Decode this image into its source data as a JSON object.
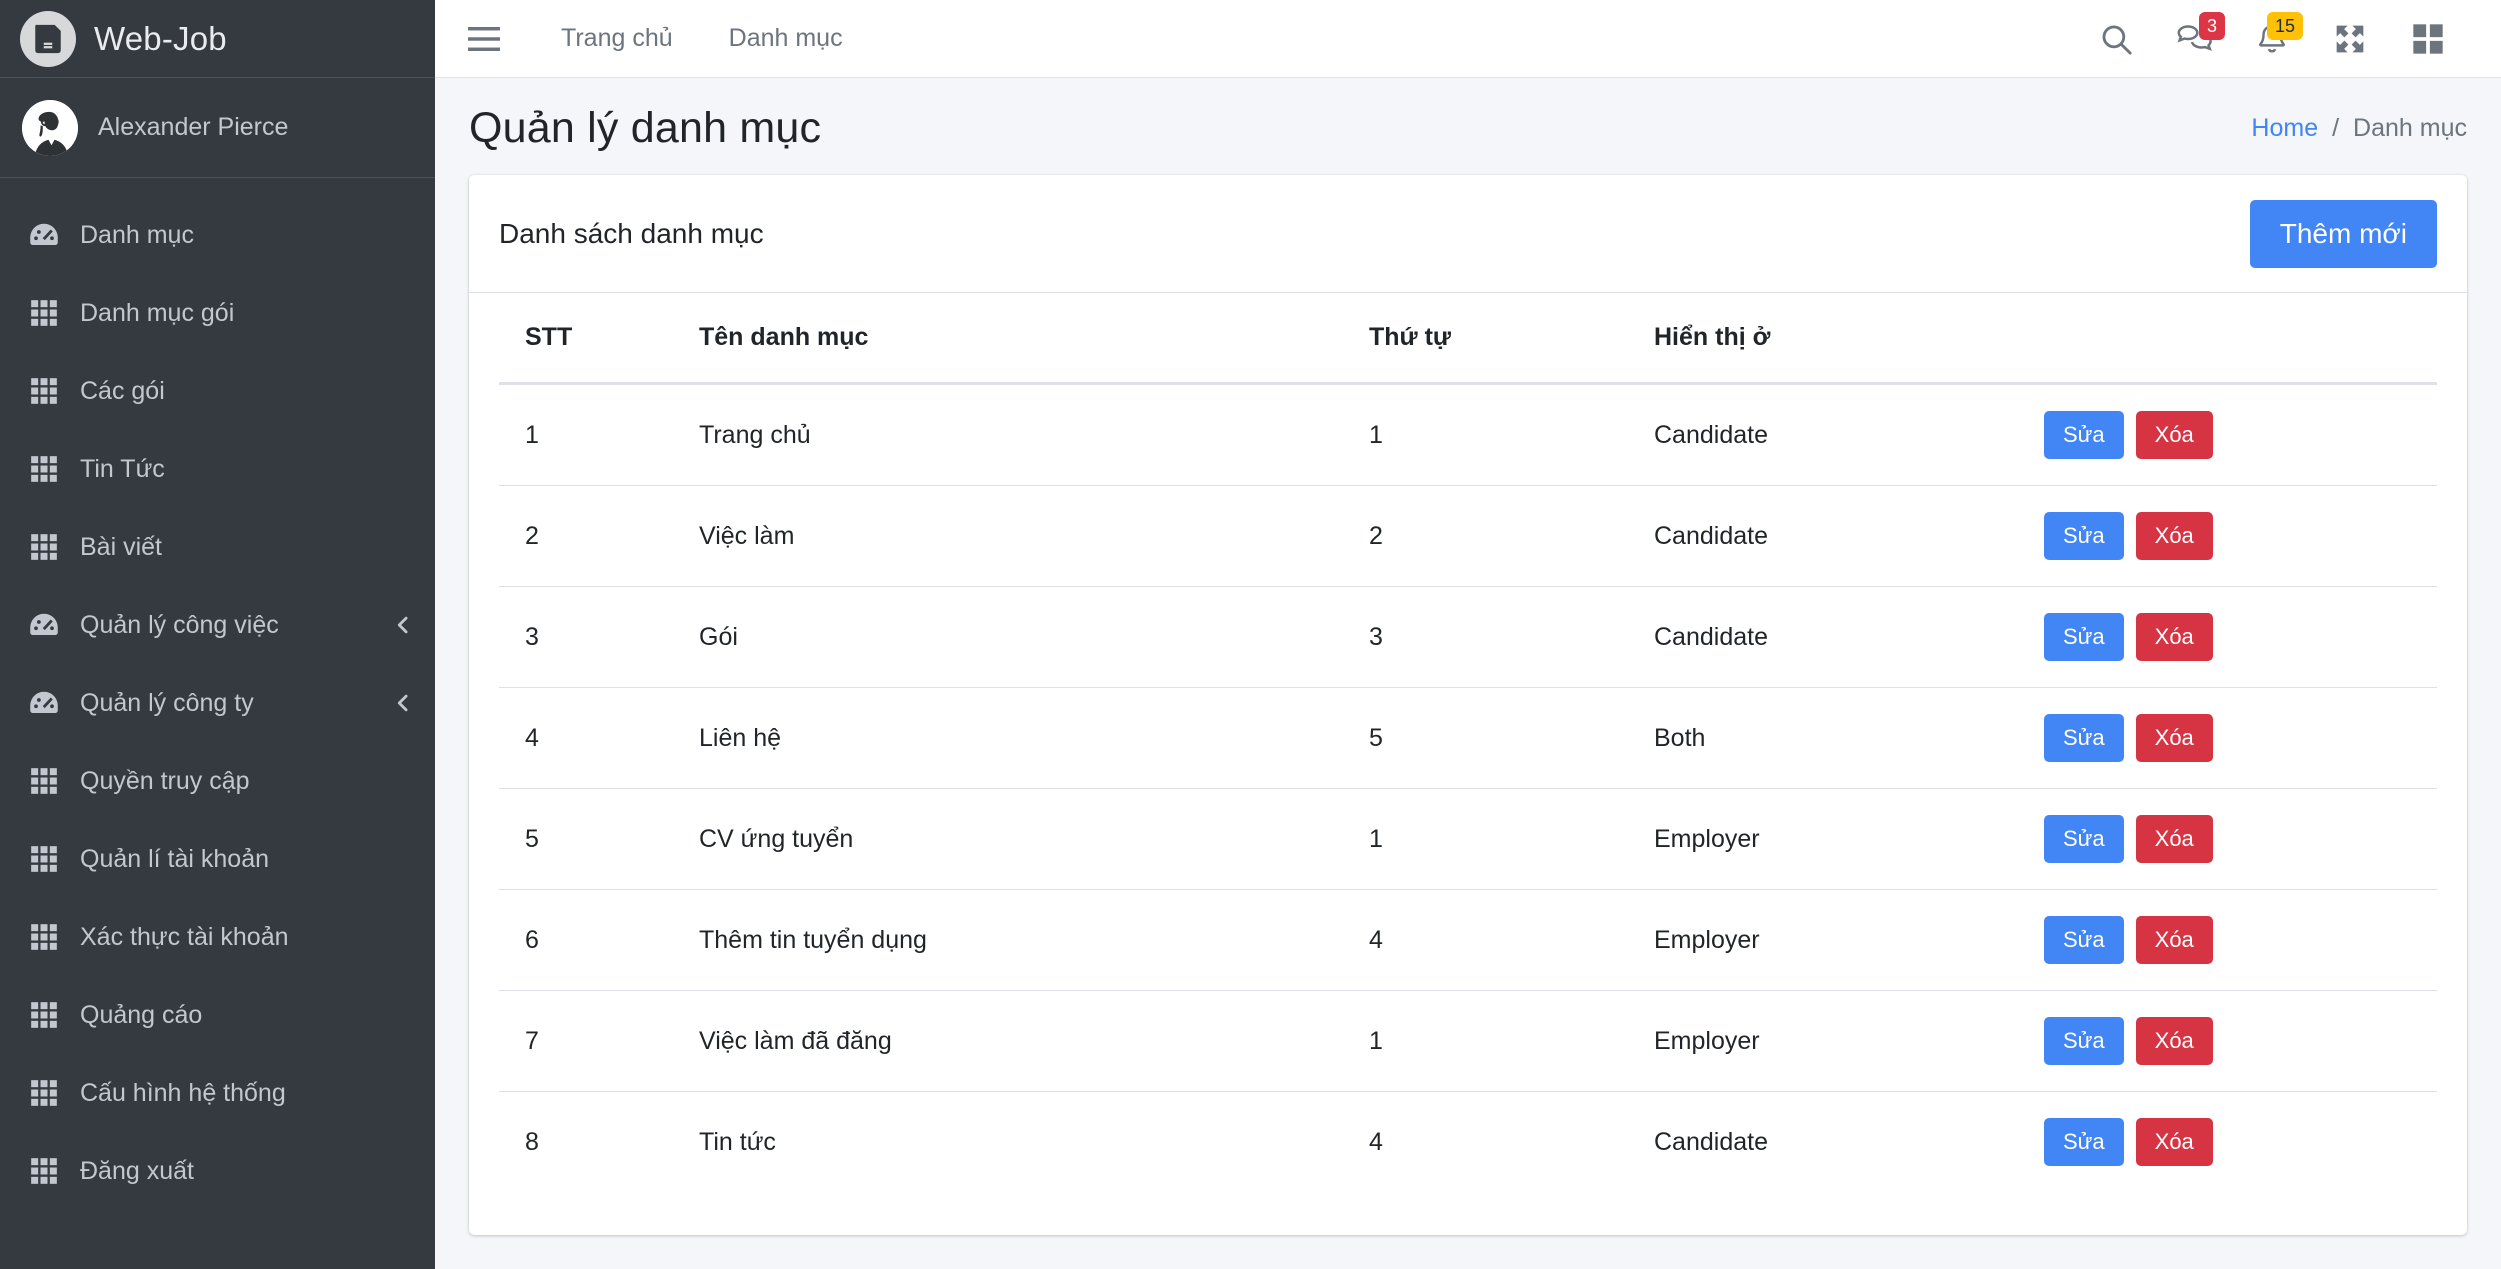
{
  "brand": {
    "name": "Web-Job",
    "logo_icon": "save-disk-icon"
  },
  "user": {
    "name": "Alexander Pierce",
    "avatar_icon": "user-avatar"
  },
  "sidebar": {
    "items": [
      {
        "label": "Danh mục",
        "icon": "dashboard-icon",
        "expandable": false
      },
      {
        "label": "Danh mục gói",
        "icon": "th-grid-icon",
        "expandable": false
      },
      {
        "label": "Các gói",
        "icon": "th-grid-icon",
        "expandable": false
      },
      {
        "label": "Tin Tức",
        "icon": "th-grid-icon",
        "expandable": false
      },
      {
        "label": "Bài viết",
        "icon": "th-grid-icon",
        "expandable": false
      },
      {
        "label": "Quản lý công việc",
        "icon": "dashboard-icon",
        "expandable": true
      },
      {
        "label": "Quản lý công ty",
        "icon": "dashboard-icon",
        "expandable": true
      },
      {
        "label": "Quyền truy cập",
        "icon": "th-grid-icon",
        "expandable": false
      },
      {
        "label": "Quản lí tài khoản",
        "icon": "th-grid-icon",
        "expandable": false
      },
      {
        "label": "Xác thực tài khoản",
        "icon": "th-grid-icon",
        "expandable": false
      },
      {
        "label": "Quảng cáo",
        "icon": "th-grid-icon",
        "expandable": false
      },
      {
        "label": "Cấu hình hệ thống",
        "icon": "th-grid-icon",
        "expandable": false
      },
      {
        "label": "Đăng xuất",
        "icon": "th-grid-icon",
        "expandable": false
      }
    ]
  },
  "navbar": {
    "menu_icon": "hamburger-icon",
    "links": [
      {
        "label": "Trang chủ"
      },
      {
        "label": "Danh mục"
      }
    ],
    "icons": [
      {
        "name": "search-icon",
        "badge": null
      },
      {
        "name": "comments-icon",
        "badge": "3"
      },
      {
        "name": "bell-icon",
        "badge": "15"
      },
      {
        "name": "expand-arrows-icon",
        "badge": null
      },
      {
        "name": "grid-blocks-icon",
        "badge": null
      }
    ]
  },
  "header": {
    "title": "Quản lý danh mục",
    "breadcrumb": {
      "home": "Home",
      "separator": "/",
      "current": "Danh mục"
    }
  },
  "card": {
    "title": "Danh sách danh mục",
    "add_button": "Thêm mới"
  },
  "table": {
    "columns": [
      "STT",
      "Tên danh mục",
      "Thứ tự",
      "Hiển thị ở",
      ""
    ],
    "actions": {
      "edit": "Sửa",
      "delete": "Xóa"
    },
    "rows": [
      {
        "stt": "1",
        "name": "Trang chủ",
        "order": "1",
        "show": "Candidate"
      },
      {
        "stt": "2",
        "name": "Việc làm",
        "order": "2",
        "show": "Candidate"
      },
      {
        "stt": "3",
        "name": "Gói",
        "order": "3",
        "show": "Candidate"
      },
      {
        "stt": "4",
        "name": "Liên hệ",
        "order": "5",
        "show": "Both"
      },
      {
        "stt": "5",
        "name": "CV ứng tuyển",
        "order": "1",
        "show": "Employer"
      },
      {
        "stt": "6",
        "name": "Thêm tin tuyển dụng",
        "order": "4",
        "show": "Employer"
      },
      {
        "stt": "7",
        "name": "Việc làm đã đăng",
        "order": "1",
        "show": "Employer"
      },
      {
        "stt": "8",
        "name": "Tin tức",
        "order": "4",
        "show": "Candidate"
      }
    ]
  },
  "colors": {
    "sidebar_bg": "#343a40",
    "primary": "#4285f4",
    "danger": "#d63343",
    "badge_danger": "#dc3545",
    "badge_warning": "#ffc107",
    "page_bg": "#f4f6f9"
  }
}
